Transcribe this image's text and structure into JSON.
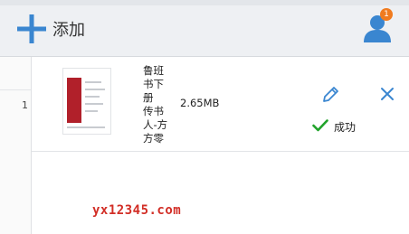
{
  "toolbar": {
    "add_label": "添加"
  },
  "user": {
    "notification_count": "1"
  },
  "files": [
    {
      "row_number": "1",
      "name": "鲁班书下册传书人-方方零",
      "name_lines": [
        "鲁班",
        "书下",
        "册",
        "传书",
        "人-方",
        "方零"
      ],
      "size": "2.65MB",
      "status": "成功"
    }
  ],
  "watermark": "yx12345.com",
  "colors": {
    "accent": "#3a86d0",
    "success": "#21a32b",
    "badge": "#f07b1f",
    "watermark": "#d22e26"
  }
}
